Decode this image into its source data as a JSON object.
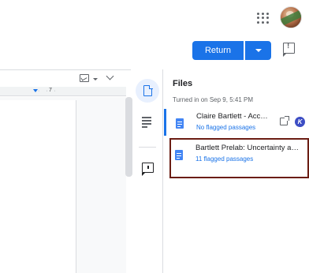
{
  "header": {
    "apps_icon": "apps-grid-icon",
    "avatar_icon": "user-avatar"
  },
  "actions": {
    "return_label": "Return",
    "return_dropdown_icon": "caret-down-icon",
    "feedback_icon": "report-feedback-icon"
  },
  "document": {
    "ruler_number": "7"
  },
  "rail": {
    "items": [
      "files-icon",
      "rubric-icon",
      "comments-icon"
    ]
  },
  "files_panel": {
    "title": "Files",
    "turned_in": "Turned in on Sep 9, 5:41 PM",
    "files": [
      {
        "name": "Claire Bartlett - Acc…",
        "subtitle": "No flagged passages",
        "icon": "google-doc-icon"
      },
      {
        "name": "Bartlett Prelab: Uncertainty a…",
        "subtitle": "11 flagged passages",
        "icon": "google-doc-icon"
      }
    ],
    "badge_letter": "K",
    "colors": {
      "accent": "#1a73e8",
      "highlight": "#6b1d13",
      "badge": "#3c4dc4"
    }
  }
}
